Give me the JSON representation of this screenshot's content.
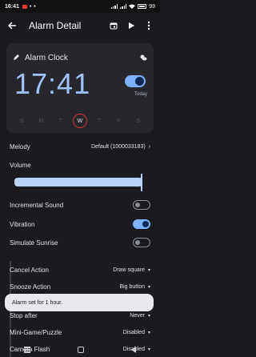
{
  "status": {
    "time": "16:41",
    "dots": "• •",
    "battery": "99"
  },
  "appbar": {
    "title": "Alarm Detail"
  },
  "alarm": {
    "label": "Alarm Clock",
    "time": "17:41",
    "enabled": true,
    "today_label": "Today",
    "days": [
      "S",
      "M",
      "T",
      "W",
      "T",
      "F",
      "S"
    ],
    "active_day_index": 3
  },
  "settings": {
    "melody": {
      "label": "Melody",
      "value": "Default (1000033183)"
    },
    "volume": {
      "label": "Volume",
      "level": 0.98
    },
    "incremental_sound": {
      "label": "Incremental Sound",
      "on": false
    },
    "vibration": {
      "label": "Vibration",
      "on": true
    },
    "simulate_sunrise": {
      "label": "Simulate Sunrise",
      "on": false
    },
    "cancel_action": {
      "label": "Cancel Action",
      "value": "Draw square"
    },
    "snooze_action": {
      "label": "Snooze Action",
      "value": "Big button"
    },
    "stop_after": {
      "label": "Stop after",
      "value": "Never"
    },
    "mini_game": {
      "label": "Mini-Game/Puzzle",
      "value": "Disabled"
    },
    "camera_flash": {
      "label": "Camera Flash",
      "value": "Disabled"
    }
  },
  "snackbar": {
    "message": "Alarm set for 1 hour."
  },
  "colors": {
    "accent": "#7eb2ff",
    "time": "#9fc3ff",
    "today_ring": "#d02e2e",
    "background": "#1b1b1f",
    "card": "#26262c"
  }
}
